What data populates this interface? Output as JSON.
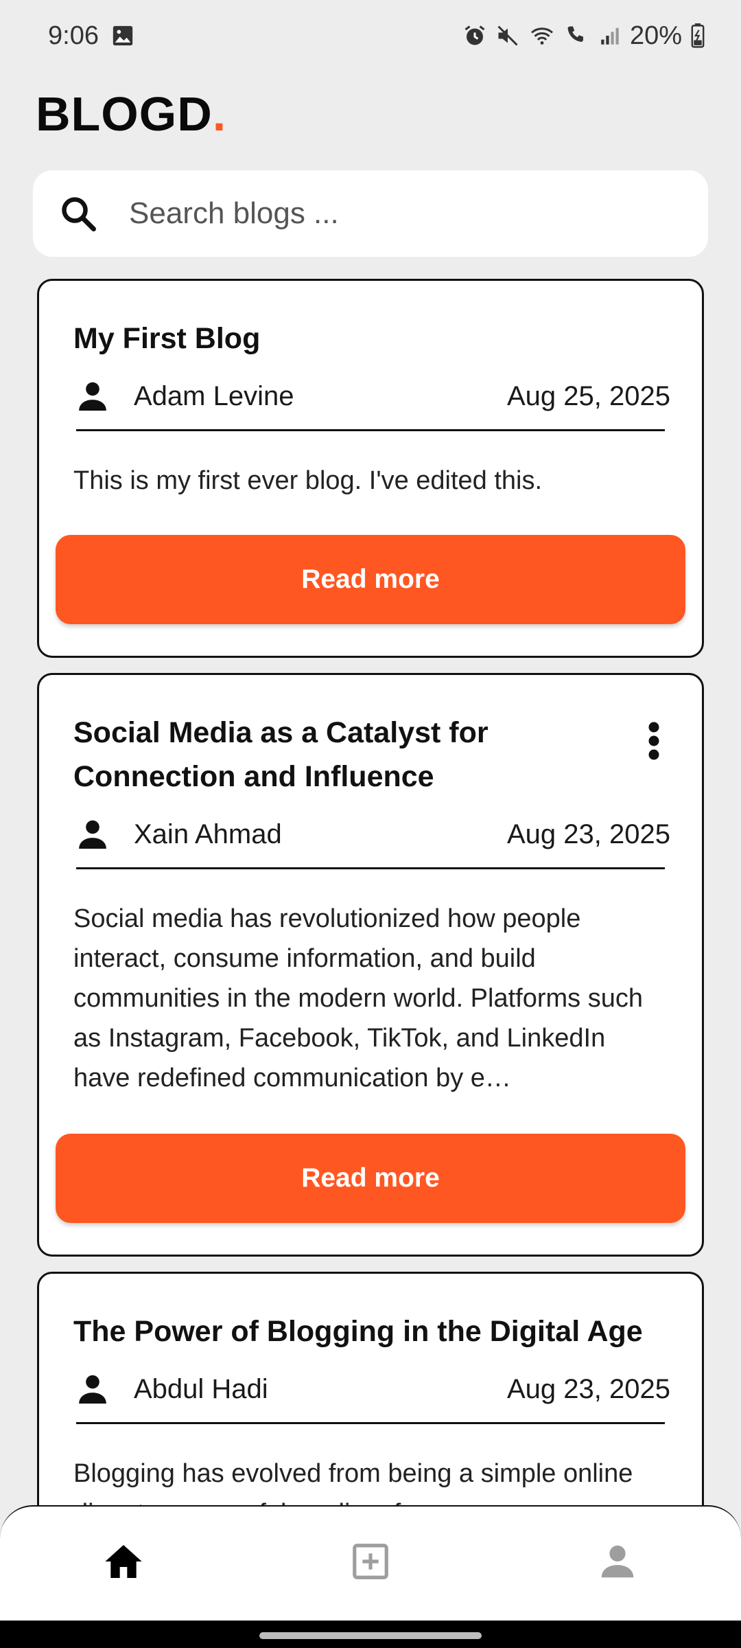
{
  "status_bar": {
    "time": "9:06",
    "battery": "20%"
  },
  "app": {
    "title": "BLOGD",
    "title_dot": ".",
    "accent_color": "#ff5722"
  },
  "search": {
    "placeholder": "Search blogs ...",
    "value": ""
  },
  "posts": [
    {
      "title": "My First Blog",
      "author": "Adam Levine",
      "date": "Aug 25, 2025",
      "excerpt": "This is my first ever blog. I've edited this.",
      "button_label": "Read more",
      "has_menu": false
    },
    {
      "title": "Social Media as a Catalyst for Connection and Influence",
      "author": "Xain Ahmad",
      "date": "Aug 23, 2025",
      "excerpt": "Social media has revolutionized how people interact, consume information, and build communities in the modern world. Platforms such as Instagram, Facebook, TikTok, and LinkedIn have redefined communication by e…",
      "button_label": "Read more",
      "has_menu": true
    },
    {
      "title": "The Power of Blogging in the Digital Age",
      "author": "Abdul Hadi",
      "date": "Aug 23, 2025",
      "excerpt": "Blogging has evolved from being a simple online diary to a powerful medium for"
    }
  ],
  "bottom_nav": {
    "items": [
      {
        "icon": "home-icon",
        "active": true
      },
      {
        "icon": "add-post-icon",
        "active": false
      },
      {
        "icon": "profile-icon",
        "active": false
      }
    ]
  }
}
